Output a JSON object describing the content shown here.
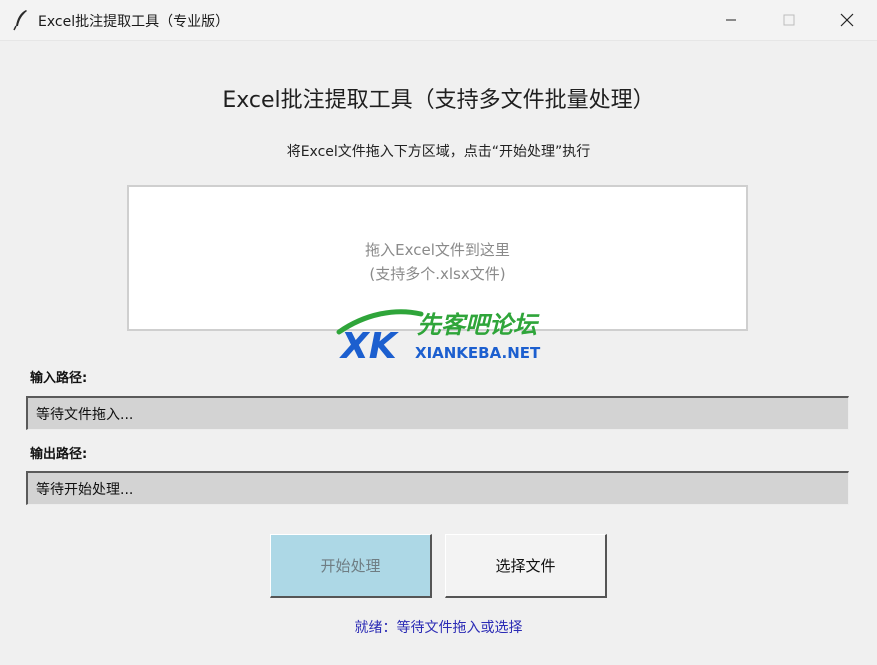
{
  "window": {
    "title": "Excel批注提取工具（专业版）",
    "icon": "feather-icon",
    "controls": [
      "minimize-icon",
      "maximize-icon",
      "close-icon"
    ]
  },
  "main": {
    "heading": "Excel批注提取工具（支持多文件批量处理）",
    "instruction": "将Excel文件拖入下方区域，点击“开始处理”执行",
    "dropzone": {
      "line1": "拖入Excel文件到这里",
      "line2": "(支持多个.xlsx文件)"
    },
    "watermark": {
      "logo_letters": "XK",
      "brand_cn": "先客吧论坛",
      "brand_en": "XIANKEBA.NET",
      "colors": {
        "green": "#2fa53a",
        "blue": "#1c5fcf"
      }
    },
    "input_path": {
      "label": "输入路径:",
      "value": "等待文件拖入..."
    },
    "output_path": {
      "label": "输出路径:",
      "value": "等待开始处理..."
    },
    "buttons": {
      "start": "开始处理",
      "select": "选择文件"
    },
    "status": "就绪：等待文件拖入或选择"
  },
  "colors": {
    "background": "#f0f0f0",
    "start_button": "#add8e6",
    "status_text": "#2b2bb5",
    "field_bg": "#d3d3d3"
  }
}
